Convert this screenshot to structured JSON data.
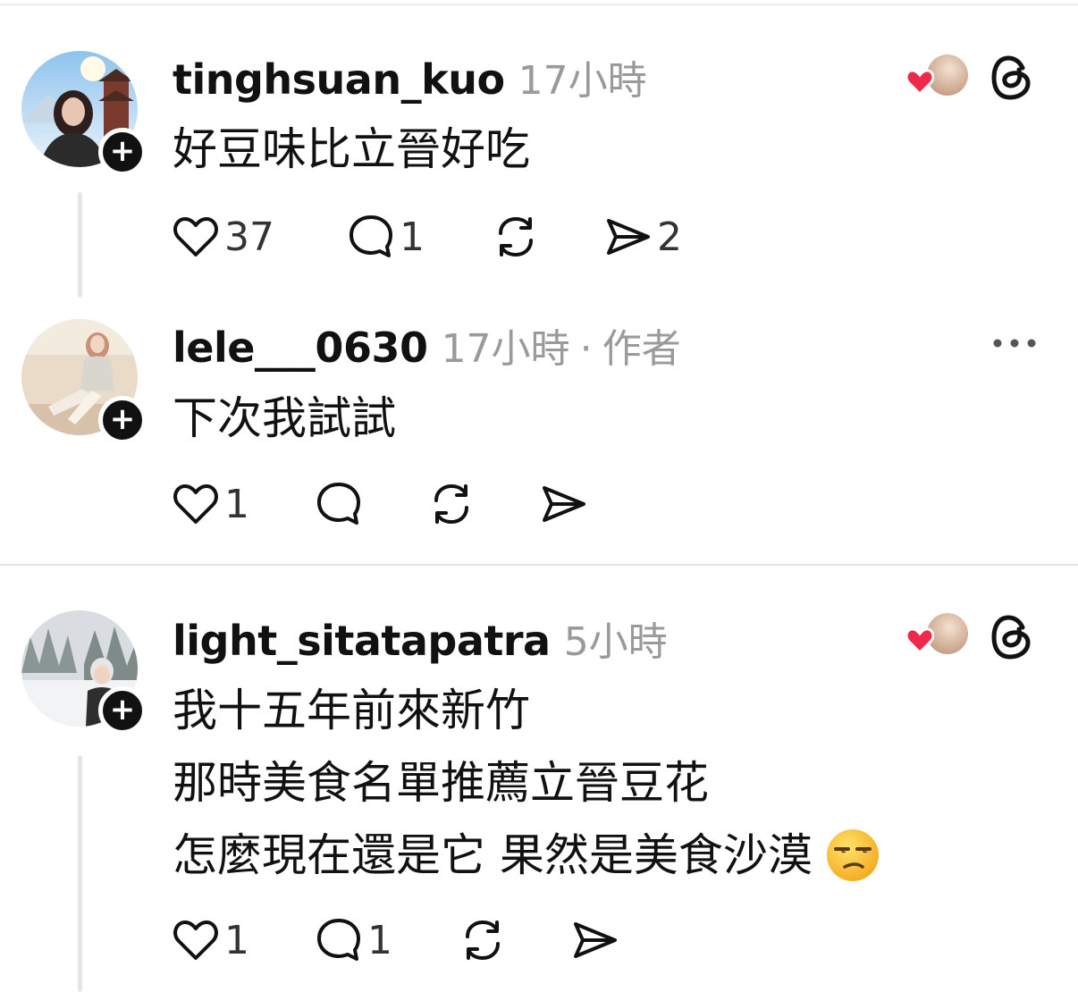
{
  "comments": [
    {
      "username": "tinghsuan_kuo",
      "time": "17小時",
      "lines": [
        "好豆味比立晉好吃"
      ],
      "likes": "37",
      "replies": "1",
      "shares": "2",
      "liked_by_author": true,
      "follow_badge": "+"
    },
    {
      "username": "lele___0630",
      "time": "17小時",
      "separator": "·",
      "author_label": "作者",
      "lines": [
        "下次我試試"
      ],
      "likes": "1",
      "follow_badge": "+"
    },
    {
      "username": "light_sitatapatra",
      "time": "5小時",
      "lines": [
        "我十五年前來新竹",
        "那時美食名單推薦立晉豆花",
        "怎麼現在還是它 果然是美食沙漠"
      ],
      "emoji": "unamused-face",
      "likes": "1",
      "replies": "1",
      "liked_by_author": true,
      "follow_badge": "+"
    }
  ],
  "icons": {
    "like": "heart-outline-icon",
    "reply": "speech-bubble-icon",
    "repost": "repost-icon",
    "share": "paper-plane-icon",
    "threads": "threads-logo-icon",
    "more": "more-horizontal-icon",
    "liked_heart": "red-heart-icon"
  },
  "colors": {
    "liked_heart": "#f02849",
    "text_primary": "#111111",
    "text_secondary": "#9a9a9a"
  }
}
